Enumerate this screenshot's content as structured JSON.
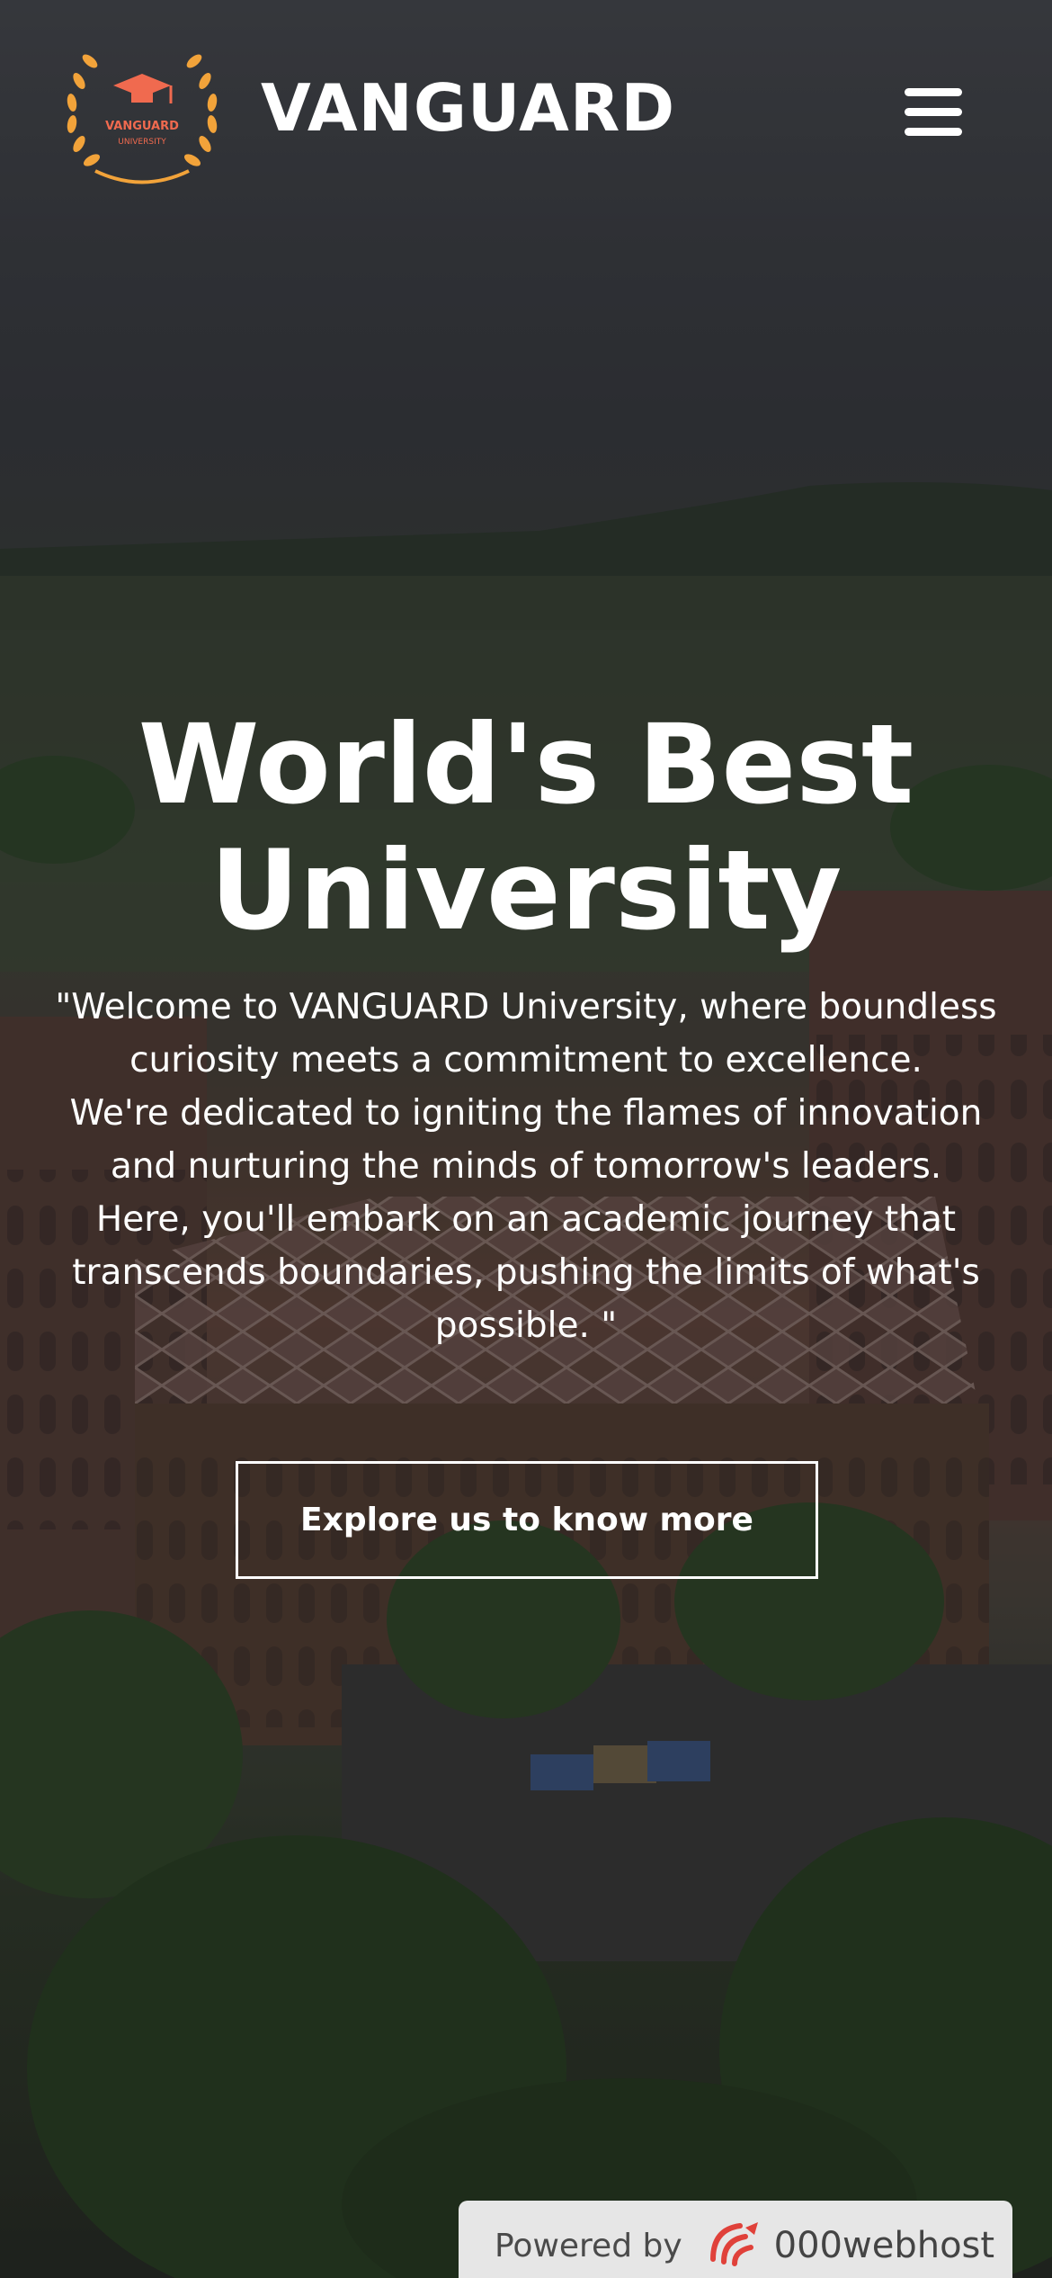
{
  "header": {
    "brand": "VANGUARD",
    "logo_text_top": "VANGUARD",
    "logo_text_bottom": "UNIVERSITY",
    "menu_icon": "hamburger-menu-icon"
  },
  "hero": {
    "headline_line1": "World's Best",
    "headline_line2": "University",
    "intro_lines": [
      "\"Welcome to VANGUARD University, where boundless",
      "curiosity meets a commitment to excellence.",
      "We're dedicated to igniting the flames of innovation",
      "and nurturing the minds of tomorrow's leaders.",
      "Here, you'll embark on an academic journey that",
      "transcends boundaries, pushing the limits of what's",
      "possible. \""
    ],
    "cta_label": "Explore us to know more"
  },
  "footer_badge": {
    "prefix": "Powered by",
    "brand": "000webhost",
    "icon": "000webhost-logo-icon"
  },
  "colors": {
    "logo_accent": "#f06a4f",
    "logo_laurel": "#f2a33a",
    "text": "#ffffff",
    "badge_bg": "#e6e6e6"
  }
}
